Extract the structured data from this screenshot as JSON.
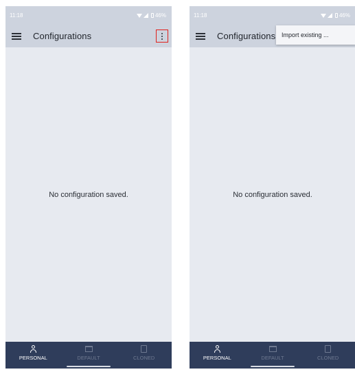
{
  "screens": [
    {
      "status": {
        "time": "11:18",
        "battery": "46%"
      },
      "app_bar": {
        "title": "Configurations"
      },
      "empty_message": "No configuration saved.",
      "nav": [
        {
          "label": "PERSONAL",
          "icon": "person-icon",
          "active": true
        },
        {
          "label": "DEFAULT",
          "icon": "factory-icon",
          "active": false
        },
        {
          "label": "CLONED",
          "icon": "clone-icon",
          "active": false
        }
      ],
      "more_button_highlighted": true
    },
    {
      "status": {
        "time": "11:18",
        "battery": "46%"
      },
      "app_bar": {
        "title": "Configurations"
      },
      "overflow_menu": {
        "items": [
          "Import existing ..."
        ]
      },
      "empty_message": "No configuration saved.",
      "nav": [
        {
          "label": "PERSONAL",
          "icon": "person-icon",
          "active": true
        },
        {
          "label": "DEFAULT",
          "icon": "factory-icon",
          "active": false
        },
        {
          "label": "CLONED",
          "icon": "clone-icon",
          "active": false
        }
      ]
    }
  ],
  "colors": {
    "app_bar": "#cdd3de",
    "background": "#e7eaf0",
    "bottom_nav": "#2f3d5b",
    "nav_active": "#ffffff",
    "nav_inactive": "#6f7a91",
    "highlight": "#e0201b"
  }
}
